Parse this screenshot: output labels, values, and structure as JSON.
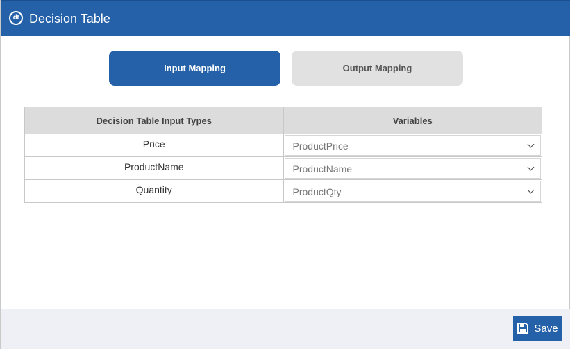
{
  "window": {
    "logo_text": "dt",
    "title": "Decision Table"
  },
  "tabs": [
    {
      "label": "Input Mapping",
      "active": true
    },
    {
      "label": "Output Mapping",
      "active": false
    }
  ],
  "table": {
    "headers": [
      "Decision Table Input Types",
      "Variables"
    ],
    "rows": [
      {
        "type": "Price",
        "variable": "ProductPrice"
      },
      {
        "type": "ProductName",
        "variable": "ProductName"
      },
      {
        "type": "Quantity",
        "variable": "ProductQty"
      }
    ]
  },
  "footer": {
    "save_label": "Save"
  },
  "colors": {
    "primary": "#2561a8",
    "tab_inactive": "#e1e1e1",
    "header_bg": "#dcdcdc",
    "footer_bg": "#eff0f6"
  }
}
